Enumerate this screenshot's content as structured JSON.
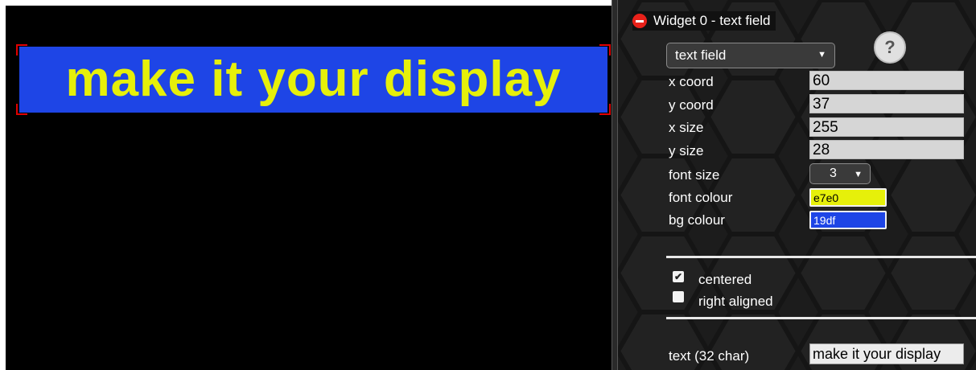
{
  "canvas": {
    "preview_text": "make it your display",
    "font_colour": "#e6f00a",
    "bg_colour": "#1e45e6"
  },
  "panel": {
    "widget_title": "Widget 0 - text field",
    "type_select": {
      "value": "text field"
    },
    "help_label": "?",
    "fields": {
      "x_coord": {
        "label": "x coord",
        "value": "60"
      },
      "y_coord": {
        "label": "y coord",
        "value": "37"
      },
      "x_size": {
        "label": "x size",
        "value": "255"
      },
      "y_size": {
        "label": "y size",
        "value": "28"
      }
    },
    "font_size": {
      "label": "font size",
      "value": "3"
    },
    "font_colour": {
      "label": "font colour",
      "value": "e7e0"
    },
    "bg_colour": {
      "label": "bg colour",
      "value": "19df"
    },
    "checkboxes": {
      "centered": {
        "label": "centered",
        "checked": true
      },
      "right_aligned": {
        "label": "right aligned",
        "checked": false
      }
    },
    "text": {
      "label": "text (32 char)",
      "value": "make it your display"
    }
  },
  "icons": {
    "remove": "remove-icon",
    "dropdown": "chevron-down-icon",
    "help": "question-icon",
    "checkmark": "checkmark-icon"
  }
}
